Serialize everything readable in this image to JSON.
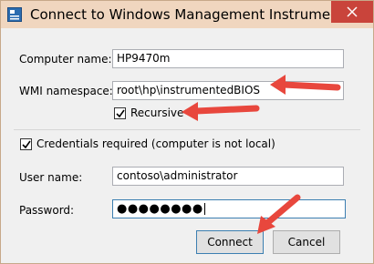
{
  "window": {
    "title": "Connect to Windows Management Instrumentatio...",
    "close_icon": "close-icon"
  },
  "form": {
    "computer_name_label": "Computer name:",
    "computer_name_value": "HP9470m",
    "wmi_namespace_label": "WMI namespace:",
    "wmi_namespace_value": "root\\hp\\instrumentedBIOS",
    "recursive_label": "Recursive",
    "recursive_checked": true,
    "credentials_label": "Credentials required (computer is not local)",
    "credentials_checked": true,
    "user_name_label": "User name:",
    "user_name_value": "contoso\\administrator",
    "password_label": "Password:",
    "password_value": "●●●●●●●●"
  },
  "buttons": {
    "connect": "Connect",
    "cancel": "Cancel"
  },
  "colors": {
    "annotation_arrow": "#e8473d",
    "title_bar": "#f0d6bf",
    "close_button": "#c9443b",
    "focus_border": "#3c7fb1"
  }
}
